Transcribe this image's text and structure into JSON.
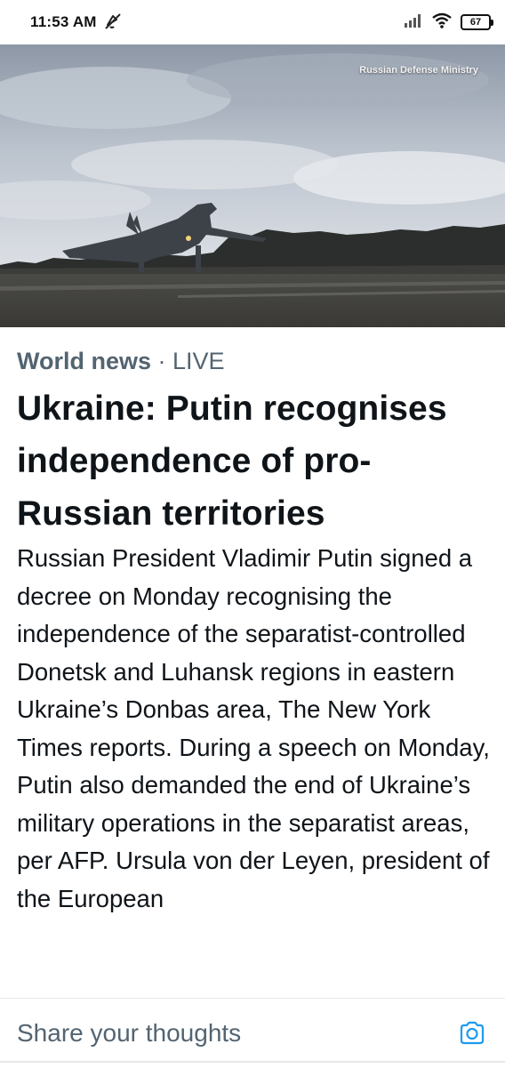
{
  "status_bar": {
    "time": "11:53 AM",
    "battery": "67",
    "icons": [
      "mute-icon",
      "signal-icon",
      "wifi-icon",
      "battery-icon"
    ]
  },
  "hero": {
    "credit": "Russian Defense Ministry",
    "image": "fighter-jet-takeoff-photo"
  },
  "article": {
    "section": "World news",
    "separator": " · ",
    "live_label": "LIVE",
    "headline": "Ukraine: Putin recognises independence of pro-Russian territories",
    "body": "Russian President Vladimir Putin signed a decree on Monday recognising the independence of the separatist-controlled Donetsk and Luhansk regions in eastern Ukraine’s Donbas area, The New York Times reports. During a speech on Monday, Putin also demanded the end of Ukraine’s military operations in the separatist areas, per AFP. Ursula von der Leyen, president of the European"
  },
  "share_bar": {
    "placeholder": "Share your thoughts",
    "accent_color": "#1d9bf0"
  }
}
